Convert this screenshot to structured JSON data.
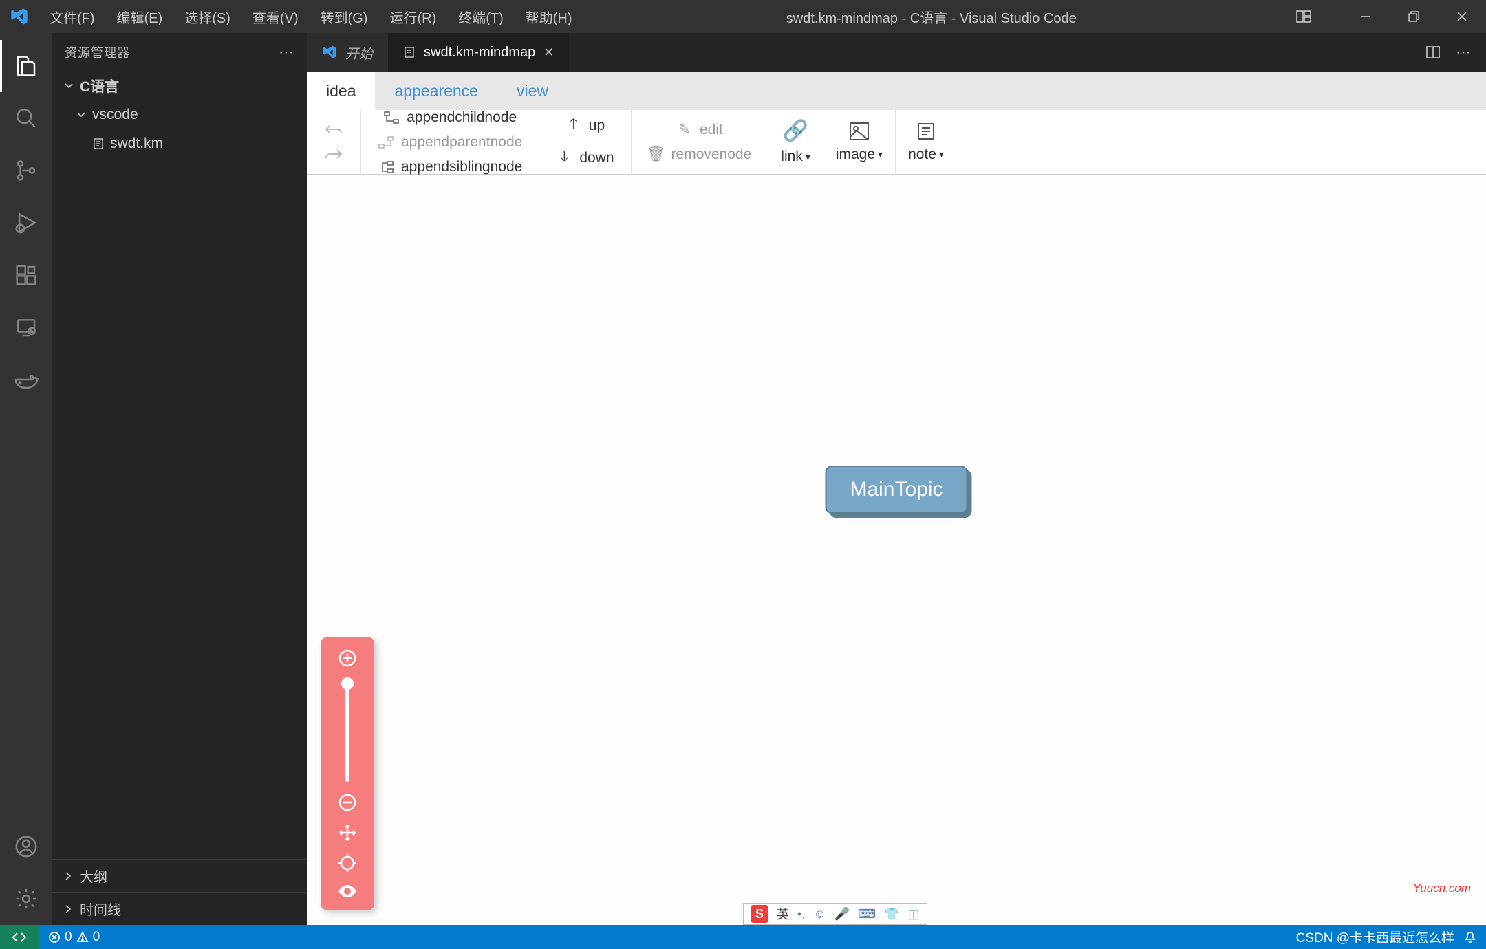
{
  "title": "swdt.km-mindmap - C语言 - Visual Studio Code",
  "menus": [
    "文件(F)",
    "编辑(E)",
    "选择(S)",
    "查看(V)",
    "转到(G)",
    "运行(R)",
    "终端(T)",
    "帮助(H)"
  ],
  "sidebar": {
    "header": "资源管理器",
    "project": "C语言",
    "items": [
      "vscode",
      "swdt.km"
    ],
    "sections": [
      "大纲",
      "时间线"
    ]
  },
  "tabs": {
    "welcome": "开始",
    "active": "swdt.km-mindmap"
  },
  "mindmap": {
    "tabs": [
      "idea",
      "appearence",
      "view"
    ],
    "toolbar": {
      "appendchild": "appendchildnode",
      "appendparent": "appendparentnode",
      "appendsibling": "appendsiblingnode",
      "up": "up",
      "down": "down",
      "edit": "edit",
      "removenode": "removenode",
      "link": "link",
      "image": "image",
      "note": "note"
    },
    "main_topic": "MainTopic"
  },
  "status": {
    "errors": "0",
    "warnings": "0",
    "credit": "CSDN @卡卡西最近怎么样"
  },
  "ime": {
    "lang": "英"
  },
  "watermark": "Yuucn.com"
}
